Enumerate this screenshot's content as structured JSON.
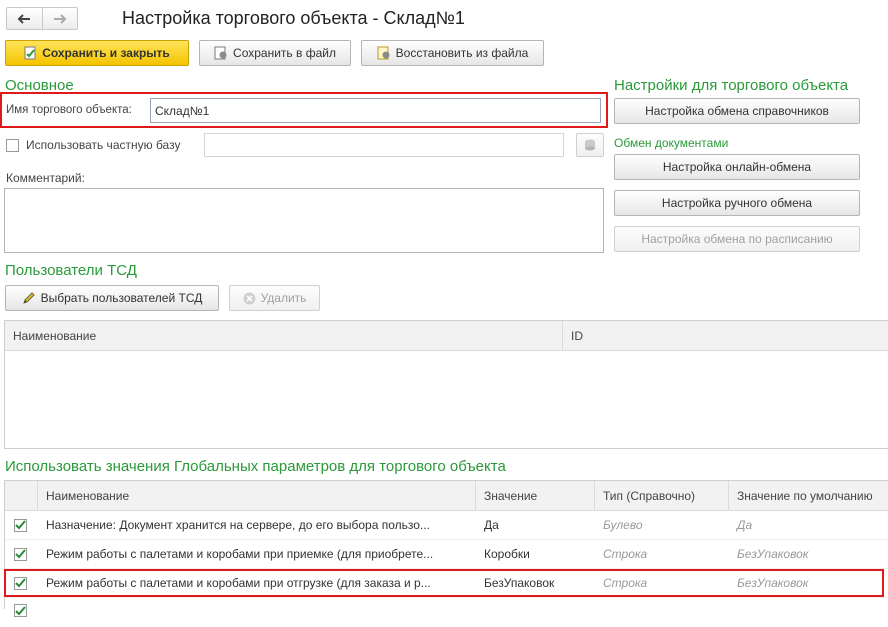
{
  "window": {
    "title": "Настройка торгового объекта - Склад№1"
  },
  "toolbar": {
    "save_close": "Сохранить и закрыть",
    "save_file": "Сохранить в файл",
    "restore_file": "Восстановить из файла"
  },
  "main": {
    "section_title": "Основное",
    "name_label": "Имя торгового объекта:",
    "name_value": "Склад№1",
    "private_base_label": "Использовать частную базу",
    "private_base_value": "",
    "comment_label": "Комментарий:",
    "comment_value": ""
  },
  "right": {
    "settings_title": "Настройки для торгового объекта",
    "refs_exchange": "Настройка обмена справочников",
    "docs_title": "Обмен документами",
    "online_exchange": "Настройка онлайн-обмена",
    "manual_exchange": "Настройка ручного обмена",
    "schedule_exchange": "Настройка обмена по расписанию"
  },
  "users": {
    "title": "Пользователи ТСД",
    "select_btn": "Выбрать пользователей ТСД",
    "delete_btn": "Удалить",
    "columns": [
      "Наименование",
      "ID"
    ]
  },
  "params": {
    "title": "Использовать значения Глобальных параметров для торгового объекта",
    "columns": [
      "Наименование",
      "Значение",
      "Тип (Справочно)",
      "Значение по умолчанию"
    ],
    "rows": [
      {
        "name": "Назначение: Документ хранится на сервере, до его выбора пользо...",
        "value": "Да",
        "type": "Булево",
        "default": "Да"
      },
      {
        "name": "Режим работы с палетами и коробами при приемке (для приобрете...",
        "value": "Коробки",
        "type": "Строка",
        "default": "БезУпаковок"
      },
      {
        "name": "Режим работы с палетами и коробами при отгрузке (для заказа и р...",
        "value": "БезУпаковок",
        "type": "Строка",
        "default": "БезУпаковок"
      }
    ]
  }
}
